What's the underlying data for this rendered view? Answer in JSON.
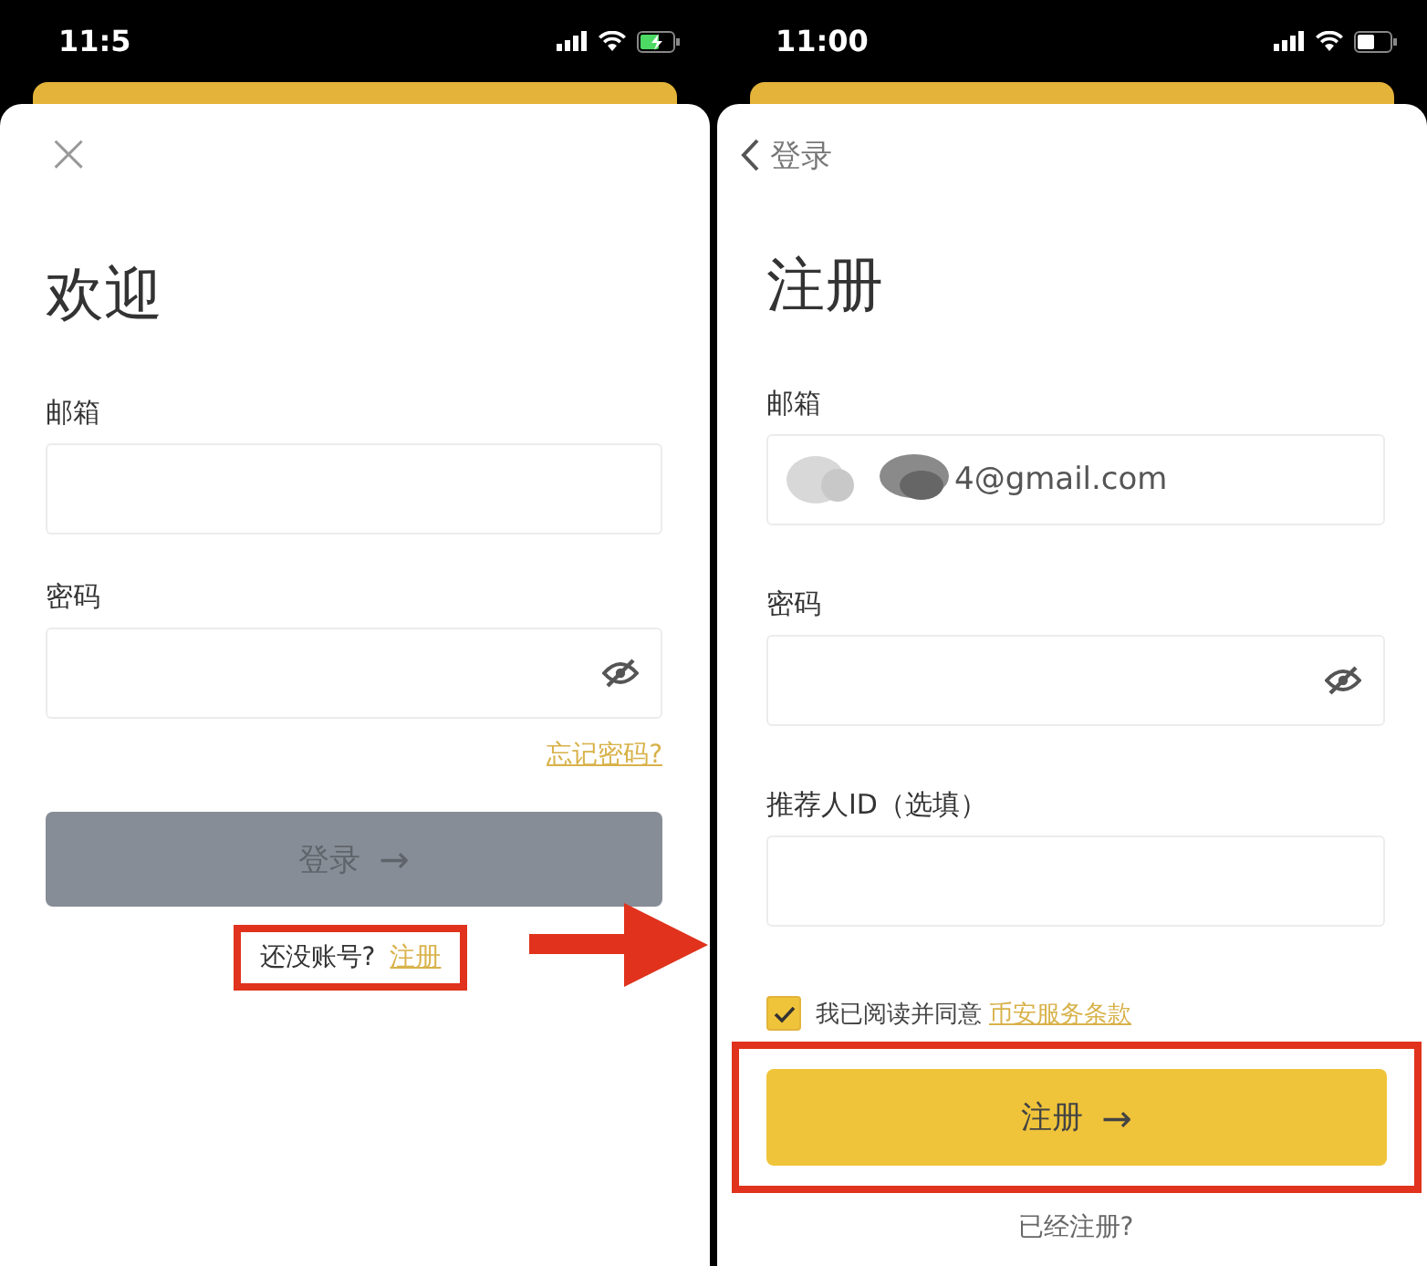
{
  "login_screen": {
    "status_bar": {
      "time": "11:5",
      "charging": true
    },
    "close_icon": "×",
    "title": "欢迎",
    "email": {
      "label": "邮箱"
    },
    "password": {
      "label": "密码",
      "hidden": true
    },
    "forgot_link": "忘记密码?",
    "login_button": {
      "label": "登录",
      "arrow": "→",
      "disabled": true
    },
    "signup_prompt": {
      "text": "还没账号?",
      "link": "注册"
    }
  },
  "register_screen": {
    "status_bar": {
      "time": "11:00",
      "charging": false
    },
    "back_link": "登录",
    "title": "注册",
    "email": {
      "label": "邮箱",
      "value": "4@gmail.com"
    },
    "password": {
      "label": "密码",
      "hidden": true
    },
    "referrer": {
      "label": "推荐人ID（选填）"
    },
    "terms": {
      "checked": true,
      "text": "我已阅读并同意",
      "link": "币安服务条款"
    },
    "register_button": {
      "label": "注册",
      "arrow": "→"
    },
    "login_prompt": "已经注册?"
  }
}
